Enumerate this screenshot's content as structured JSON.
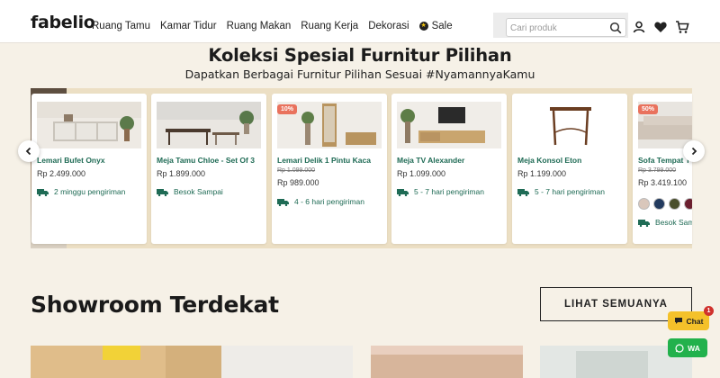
{
  "header": {
    "logo": "fabelio",
    "nav": [
      "Ruang Tamu",
      "Kamar Tidur",
      "Ruang Makan",
      "Ruang Kerja",
      "Dekorasi"
    ],
    "sale": "Sale",
    "search_placeholder": "Cari produk"
  },
  "hero": {
    "title": "Koleksi Spesial Furnitur Pilihan",
    "subtitle": "Dapatkan Berbagai Furnitur Pilihan Sesuai #NyamannyaKamu"
  },
  "products": [
    {
      "name": "Lemari Bufet Onyx",
      "old_price": "",
      "price": "Rp 2.499.000",
      "shipping": "2 minggu pengiriman",
      "badge": ""
    },
    {
      "name": "Meja Tamu Chloe - Set Of 3",
      "old_price": "",
      "price": "Rp 1.899.000",
      "shipping": "Besok Sampai",
      "badge": ""
    },
    {
      "name": "Lemari Delik 1 Pintu Kaca",
      "old_price": "Rp 1.099.000",
      "price": "Rp 989.000",
      "shipping": "4 - 6 hari pengiriman",
      "badge": "10%"
    },
    {
      "name": "Meja TV Alexander",
      "old_price": "",
      "price": "Rp 1.099.000",
      "shipping": "5 - 7 hari pengiriman",
      "badge": ""
    },
    {
      "name": "Meja Konsol Eton",
      "old_price": "",
      "price": "Rp 1.199.000",
      "shipping": "5 - 7 hari pengiriman",
      "badge": ""
    },
    {
      "name": "Sofa Tempat T",
      "old_price": "Rp 3.799.000",
      "price": "Rp 3.419.100",
      "shipping": "Besok Sam",
      "badge": "50%"
    }
  ],
  "swatch_colors": [
    "#d9c7bb",
    "#223a5e",
    "#4a4f2c",
    "#6b1f2f"
  ],
  "showroom": {
    "title": "Showroom Terdekat",
    "see_all": "LIHAT SEMUANYA"
  },
  "widgets": {
    "chat": "Chat",
    "chat_count": "1",
    "wa": "WA"
  },
  "colors": {
    "accent_green": "#1f6b55",
    "badge_red": "#e9725d",
    "chat_yellow": "#f4c12a",
    "wa_green": "#22b14c"
  }
}
